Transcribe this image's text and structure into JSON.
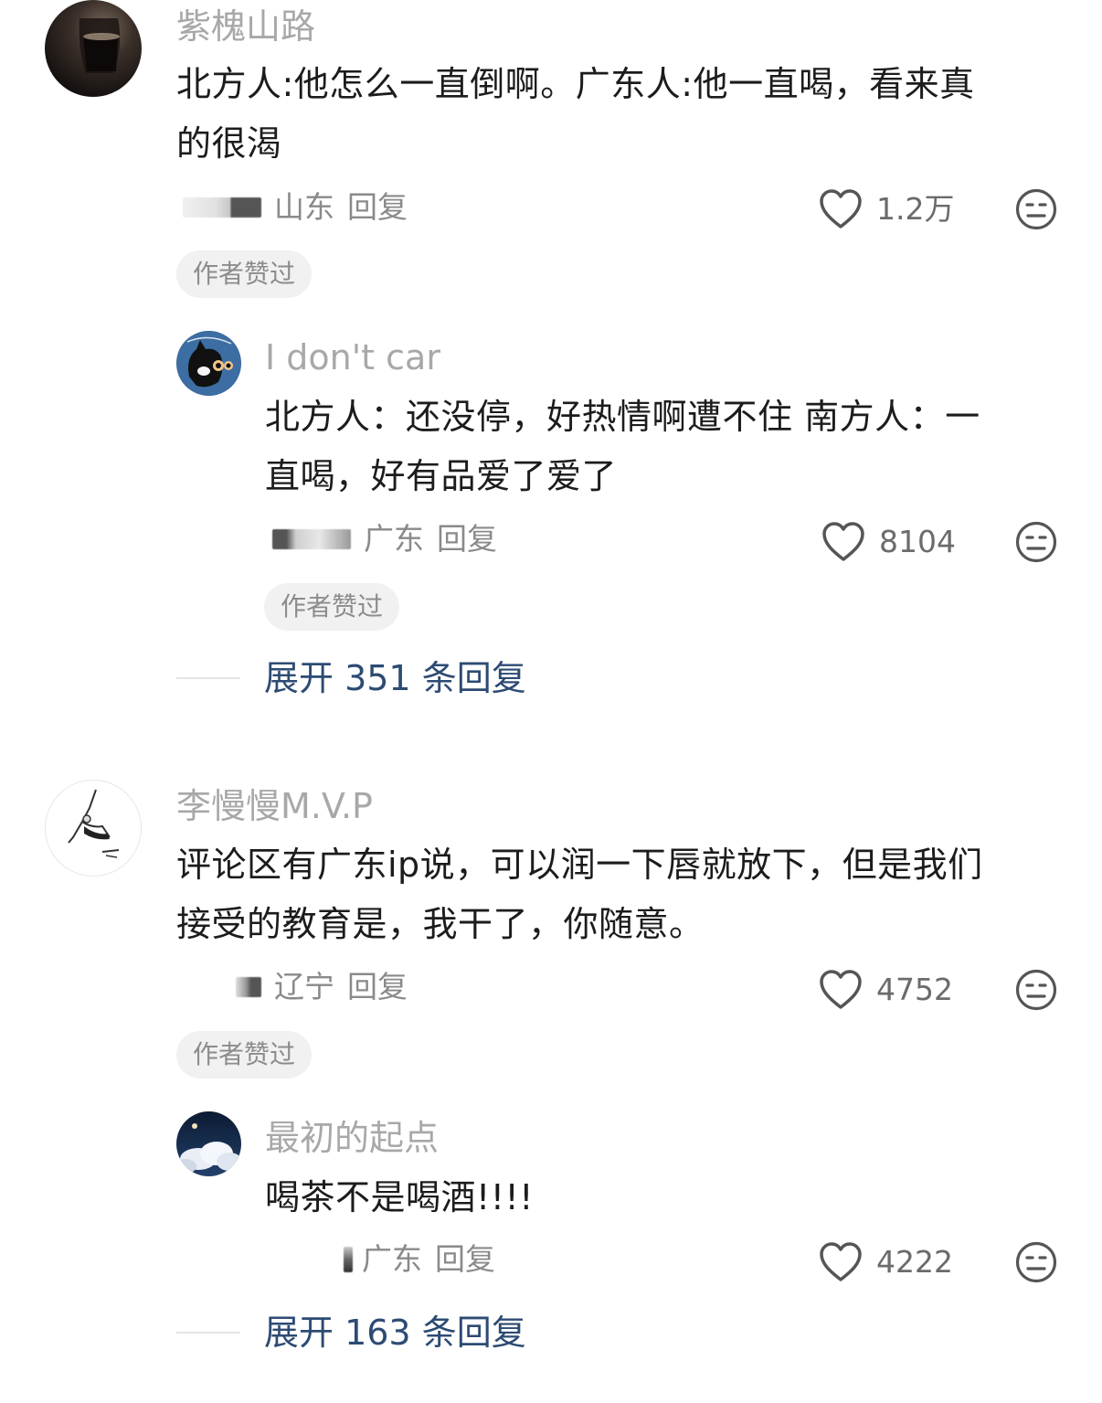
{
  "comments": [
    {
      "username": "紫槐山路",
      "text_line1": "北方人:他怎么一直倒啊。广东人:他一直喝，看来真",
      "text_line2": "的很渴",
      "location": "山东",
      "reply_label": "回复",
      "likes": "1.2万",
      "badge": "作者赞过",
      "replies": [
        {
          "username": "I don't car",
          "text_line1": "北方人：还没停，好热情啊遭不住 南方人：一",
          "text_line2": "直喝，好有品爱了爱了",
          "location": "广东",
          "reply_label": "回复",
          "likes": "8104",
          "badge": "作者赞过"
        }
      ],
      "expand_label": "展开 351 条回复"
    },
    {
      "username": "李慢慢M.V.P",
      "text_line1": "评论区有广东ip说，可以润一下唇就放下，但是我们",
      "text_line2": "接受的教育是，我干了，你随意。",
      "location": "辽宁",
      "reply_label": "回复",
      "likes": "4752",
      "badge": "作者赞过",
      "replies": [
        {
          "username": "最初的起点",
          "text_line1": "喝茶不是喝酒!!!!",
          "location": "广东",
          "reply_label": "回复",
          "likes": "4222"
        }
      ],
      "expand_label": "展开 163 条回复"
    }
  ],
  "colors": {
    "username": "#a8a8a8",
    "text": "#1c1c1c",
    "meta": "#8a8a8a",
    "expand": "#2d4b73",
    "badge_bg": "#f1f1f1"
  },
  "icons": {
    "like": "heart-outline-icon",
    "dislike": "meh-face-icon"
  }
}
